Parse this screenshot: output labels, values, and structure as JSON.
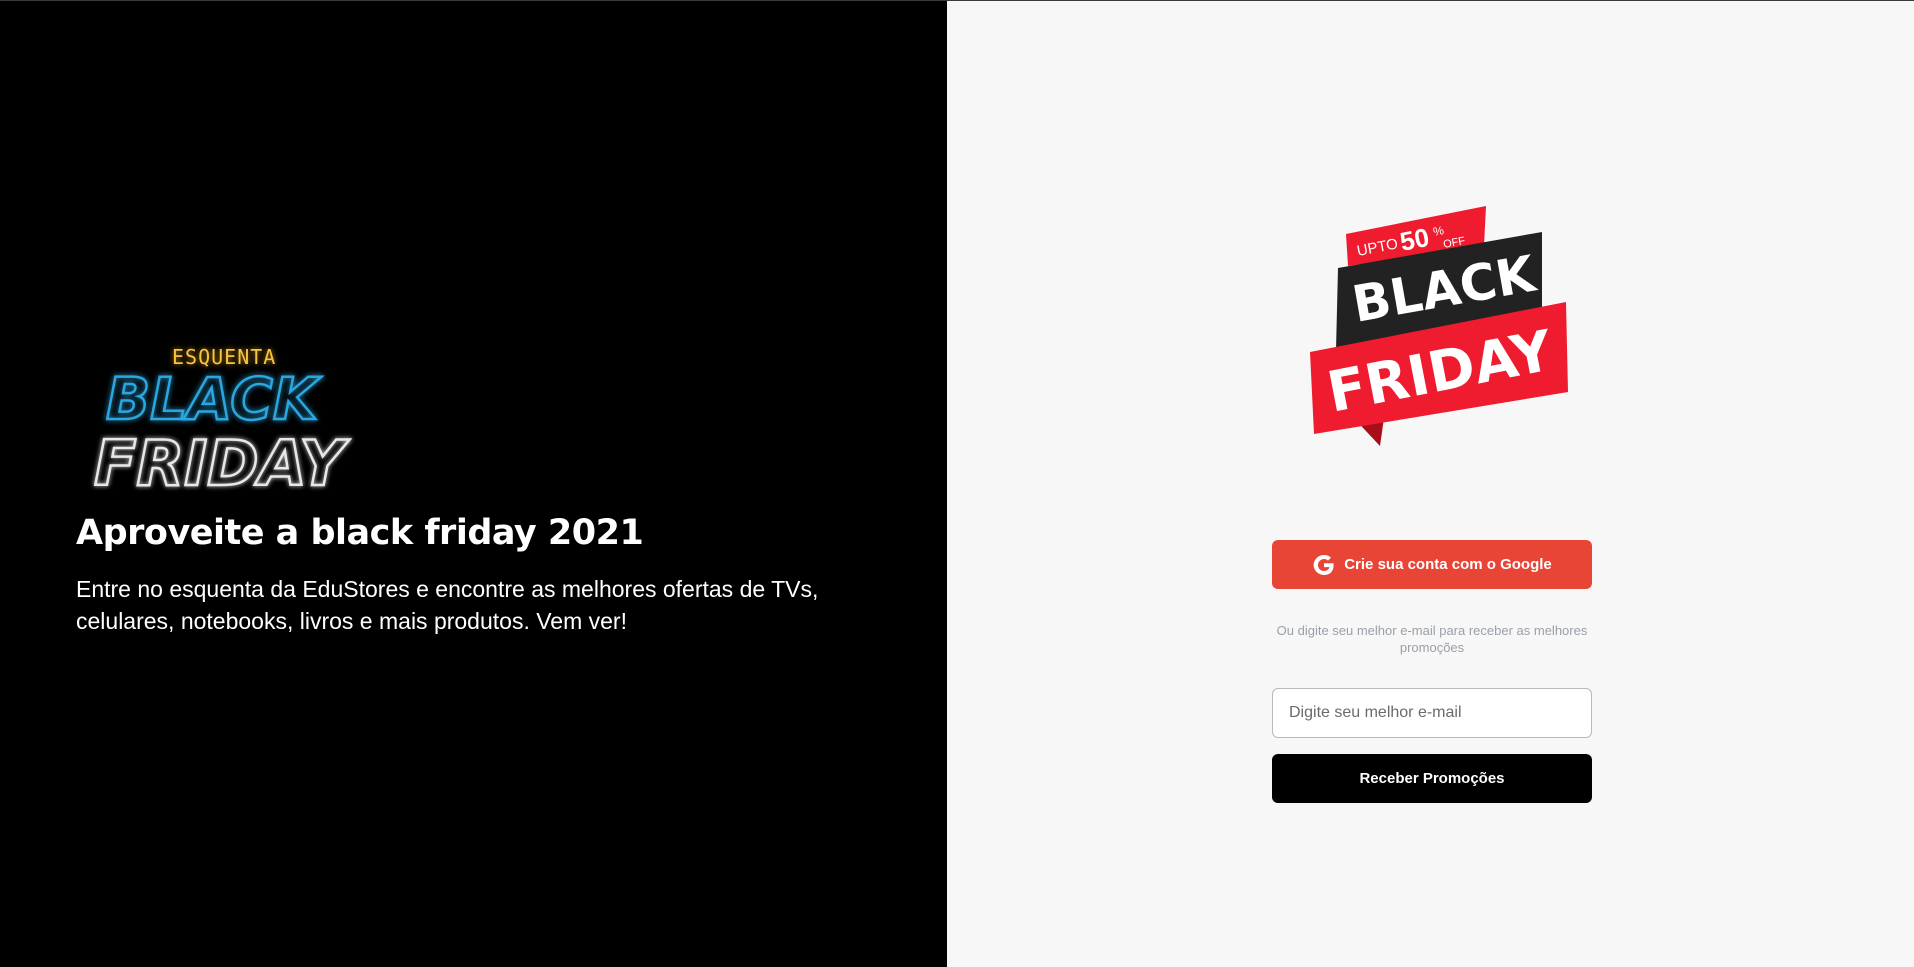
{
  "hero": {
    "logo_top": "ESQUENTA",
    "logo_black": "BLACK",
    "logo_friday": "FRIDAY",
    "headline": "Aproveite a black friday 2021",
    "description": "Entre no esquenta da EduStores e encontre as melhores ofertas de TVs, celulares, notebooks, livros e mais produtos. Vem ver!"
  },
  "promo_logo": {
    "upto": "UPTO",
    "percent": "50",
    "percent_sign": "%",
    "off": "OFF",
    "black": "BLACK",
    "friday": "FRIDAY"
  },
  "signup": {
    "google_button": "Crie sua conta com o Google",
    "hint": "Ou digite seu melhor e-mail para receber as melhores promoções",
    "email_placeholder": "Digite seu melhor e-mail",
    "email_value": "",
    "submit_button": "Receber Promoções"
  },
  "colors": {
    "left_bg": "#000000",
    "right_bg": "#f7f7f7",
    "google_red": "#e94536",
    "ribbon_red": "#ee1c2e",
    "ribbon_dark": "#222222"
  }
}
